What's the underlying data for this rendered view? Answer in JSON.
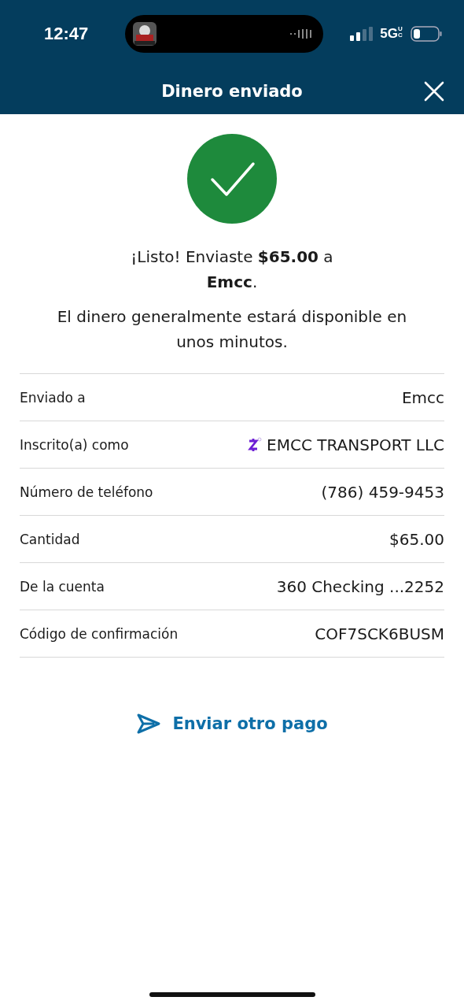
{
  "status_bar": {
    "time": "12:47",
    "network": "5G",
    "network_badge": "UC"
  },
  "header": {
    "title": "Dinero enviado"
  },
  "message": "¡Listo! Enviaste **$65.00** a **Emcc**.",
  "note": "El dinero generalmente estará disponible en unos minutos.",
  "details": [
    {
      "label": "Enviado a",
      "value": "Emcc",
      "kind": "plain"
    },
    {
      "label": "Inscrito(a) como",
      "value": "EMCC TRANSPORT LLC",
      "kind": "zelle"
    },
    {
      "label": "Número de teléfono",
      "value": "(786) 459-9453",
      "kind": "plain"
    },
    {
      "label": "Cantidad",
      "value": "$65.00",
      "kind": "plain"
    },
    {
      "label": "De la cuenta",
      "value": "360 Checking ...2252",
      "kind": "plain"
    },
    {
      "label": "Código de confirmación",
      "value": "COF7SCK6BUSM",
      "kind": "plain"
    }
  ],
  "action": {
    "label": "Enviar otro pago"
  }
}
